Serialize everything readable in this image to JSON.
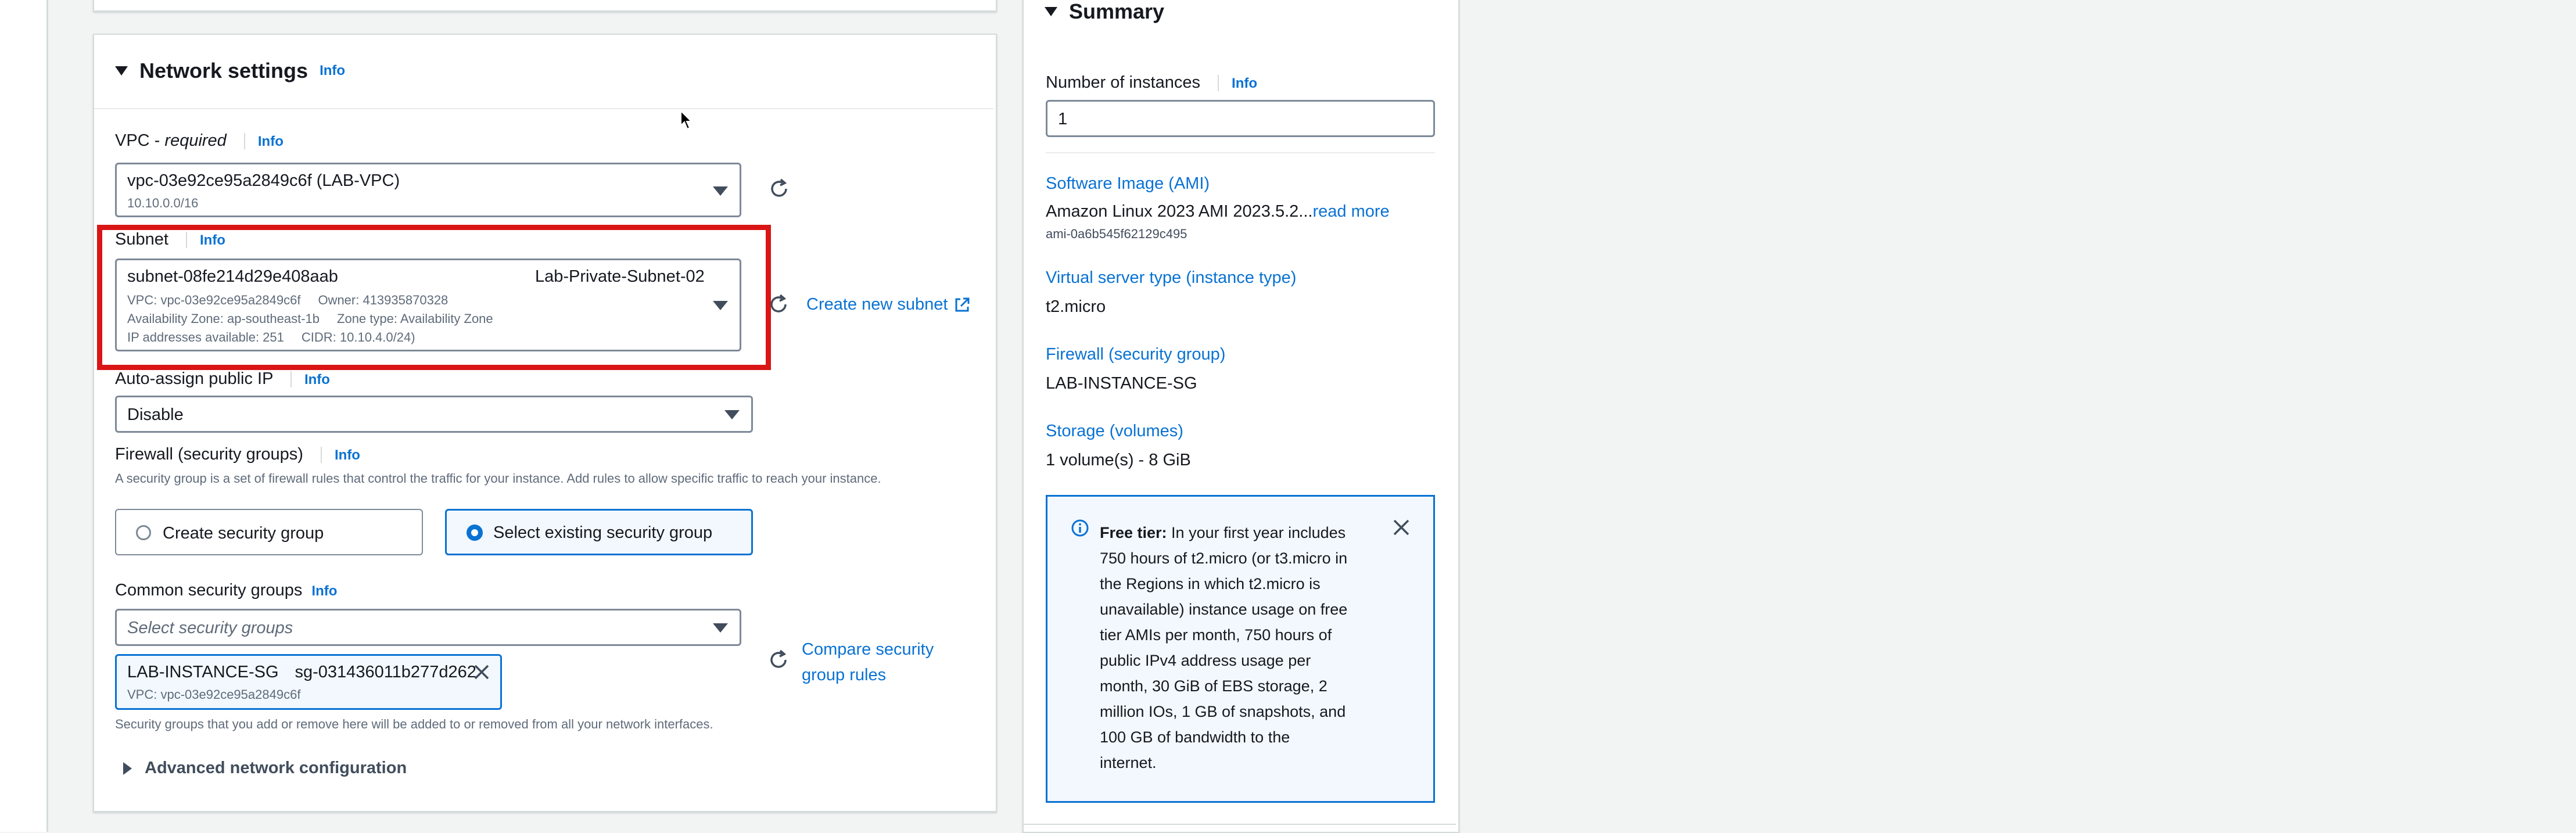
{
  "network": {
    "title": "Network settings",
    "info": "Info",
    "vpc": {
      "label_main": "VPC - ",
      "label_required": "required",
      "info": "Info",
      "value": "vpc-03e92ce95a2849c6f (LAB-VPC)",
      "cidr": "10.10.0.0/16"
    },
    "subnet": {
      "label": "Subnet",
      "info": "Info",
      "id": "subnet-08fe214d29e408aab",
      "name": "Lab-Private-Subnet-02",
      "vpc_line": "VPC: vpc-03e92ce95a2849c6f",
      "owner_line": "Owner: 413935870328",
      "az_line": "Availability Zone: ap-southeast-1b",
      "zone_type_line": "Zone type: Availability Zone",
      "ip_line": "IP addresses available: 251",
      "cidr_line": "CIDR: 10.10.4.0/24)",
      "create_link": "Create new subnet"
    },
    "auto_ip": {
      "label": "Auto-assign public IP",
      "info": "Info",
      "value": "Disable"
    },
    "firewall": {
      "label": "Firewall (security groups)",
      "info": "Info",
      "description": "A security group is a set of firewall rules that control the traffic for your instance. Add rules to allow specific traffic to reach your instance.",
      "option_create": "Create security group",
      "option_existing": "Select existing security group",
      "selected": "existing"
    },
    "common_sg": {
      "label": "Common security groups",
      "info": "Info",
      "placeholder": "Select security groups",
      "token_name": "LAB-INSTANCE-SG",
      "token_id": "sg-031436011b277d262",
      "token_vpc": "VPC: vpc-03e92ce95a2849c6f",
      "compare_link_line1": "Compare security",
      "compare_link_line2": "group rules",
      "hint": "Security groups that you add or remove here will be added to or removed from all your network interfaces."
    },
    "advanced": "Advanced network configuration"
  },
  "summary": {
    "title": "Summary",
    "instances_label": "Number of instances",
    "info": "Info",
    "instances_value": "1",
    "ami_label": "Software Image (AMI)",
    "ami_value": "Amazon Linux 2023 AMI 2023.5.2...",
    "ami_more": "read more",
    "ami_id": "ami-0a6b545f62129c495",
    "type_label": "Virtual server type (instance type)",
    "type_value": "t2.micro",
    "firewall_label": "Firewall (security group)",
    "firewall_value": "LAB-INSTANCE-SG",
    "storage_label": "Storage (volumes)",
    "storage_value": "1 volume(s) - 8 GiB",
    "free_tier_title": "Free tier:",
    "free_tier_lines": [
      " In your first year includes",
      "750 hours of t2.micro (or t3.micro in",
      "the Regions in which t2.micro is",
      "unavailable) instance usage on free",
      "tier AMIs per month, 750 hours of",
      "public IPv4 address usage per",
      "month, 30 GiB of EBS storage, 2",
      "million IOs, 1 GB of snapshots, and",
      "100 GB of bandwidth to the",
      "internet."
    ]
  },
  "colors": {
    "link": "#0972d3",
    "highlight": "#d91515",
    "selected_tile_bg": "#f2f8fd"
  }
}
